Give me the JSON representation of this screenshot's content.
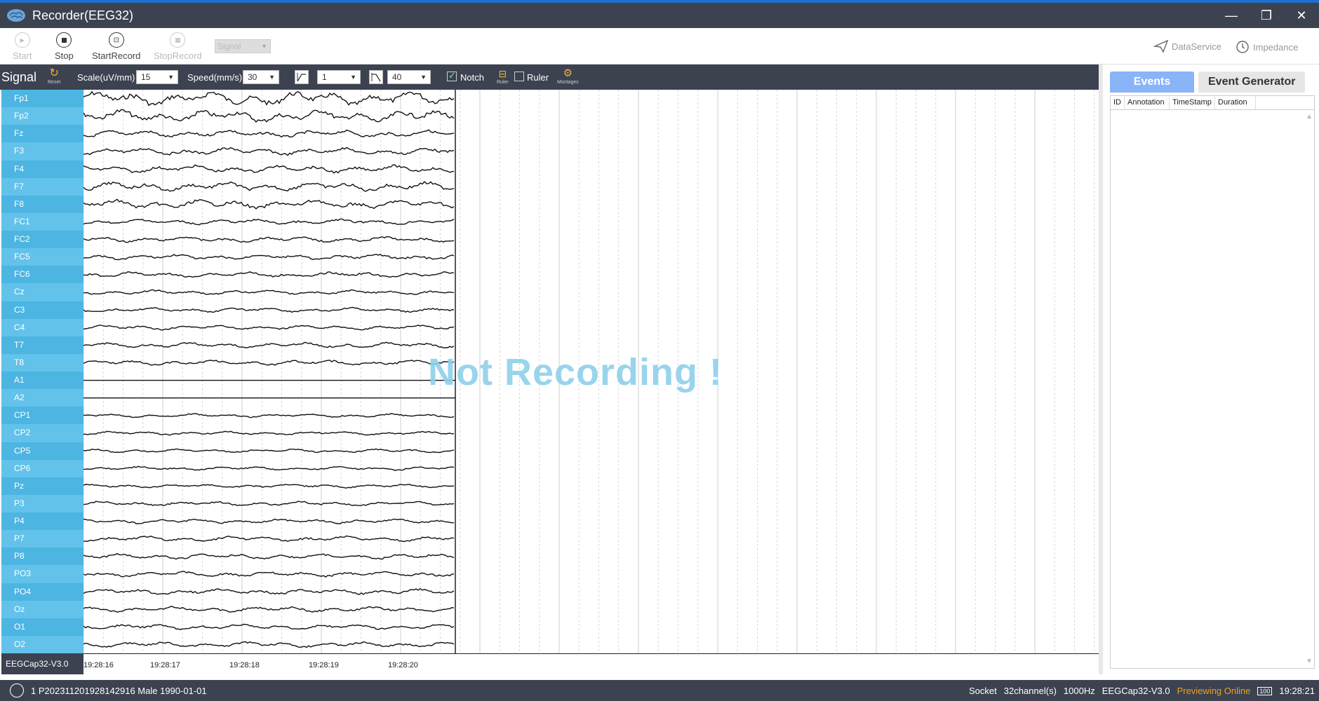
{
  "window": {
    "title": "Recorder(EEG32)"
  },
  "toolbar": {
    "start": "Start",
    "stop": "Stop",
    "start_record": "StartRecord",
    "stop_record": "StopRecord",
    "mode": "Signal",
    "data_service": "DataService",
    "impedance": "Impedance"
  },
  "signal_bar": {
    "label": "Signal",
    "reset": "Reset",
    "scale_label": "Scale(uV/mm)",
    "scale_value": "15",
    "speed_label": "Speed(mm/s)",
    "speed_value": "30",
    "highpass_value": "1",
    "lowpass_value": "40",
    "notch_label": "Notch",
    "notch_checked": true,
    "ruler_icon_label": "Ruler",
    "ruler_label": "Ruler",
    "ruler_checked": false,
    "montages": "Montages"
  },
  "channels": [
    "Fp1",
    "Fp2",
    "Fz",
    "F3",
    "F4",
    "F7",
    "F8",
    "FC1",
    "FC2",
    "FC5",
    "FC6",
    "Cz",
    "C3",
    "C4",
    "T7",
    "T8",
    "A1",
    "A2",
    "CP1",
    "CP2",
    "CP5",
    "CP6",
    "Pz",
    "P3",
    "P4",
    "P7",
    "P8",
    "PO3",
    "PO4",
    "Oz",
    "O1",
    "O2"
  ],
  "flat_channels": [
    "A1",
    "A2"
  ],
  "channel_amplitude": [
    8,
    7,
    4,
    4,
    4,
    5,
    5,
    3,
    3,
    3,
    3,
    2.5,
    2.5,
    2.5,
    3,
    3,
    0,
    0,
    2,
    2,
    2,
    2,
    2,
    2.5,
    2.5,
    3,
    3,
    3,
    3,
    3,
    3,
    3
  ],
  "overlay": "Not Recording !",
  "time_axis": [
    "19:28:16",
    "19:28:17",
    "19:28:18",
    "19:28:19",
    "19:28:20"
  ],
  "cap_name": "EEGCap32-V3.0",
  "events_panel": {
    "tabs": [
      "Events",
      "Event Generator"
    ],
    "active_tab": "Events",
    "columns": [
      "ID",
      "Annotation",
      "TimeStamp",
      "Duration"
    ]
  },
  "status": {
    "patient": "1  P202311201928142916  Male  1990-01-01",
    "connection": "Socket",
    "channels": "32channel(s)",
    "rate": "1000Hz",
    "cap": "EEGCap32-V3.0",
    "state": "Previewing Online",
    "battery": "100",
    "time": "19:28:21"
  },
  "colors": {
    "accent": "#4cb5e2",
    "dark": "#3c4250",
    "overlay": "#8fd0ec",
    "online": "#f0a020"
  }
}
